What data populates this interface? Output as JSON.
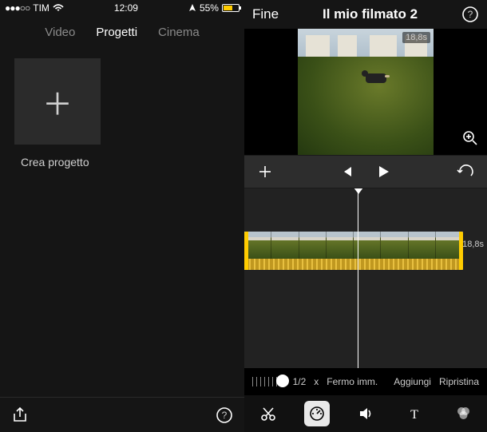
{
  "status": {
    "carrier": "TIM",
    "time": "12:09",
    "battery_pct": "55%"
  },
  "left": {
    "tabs": {
      "video": "Video",
      "progetti": "Progetti",
      "cinema": "Cinema"
    },
    "create_caption": "Crea progetto"
  },
  "right": {
    "done": "Fine",
    "title": "Il mio filmato 2",
    "preview_duration": "18,8s",
    "timeline_duration": "18,8s",
    "speed": {
      "ratio": "1/2",
      "x": "x",
      "freeze": "Fermo imm.",
      "add": "Aggiungi",
      "reset": "Ripristina"
    }
  }
}
